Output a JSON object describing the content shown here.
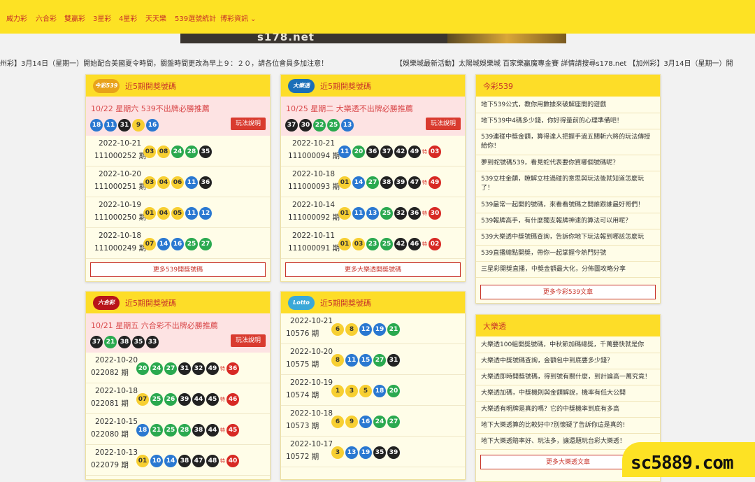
{
  "nav": {
    "items": [
      "威力彩",
      "六合彩",
      "雙贏彩",
      "3星彩",
      "4星彩",
      "天天樂",
      "539選號統計",
      "博彩資訊"
    ]
  },
  "banner": {
    "text": "s178.net"
  },
  "marquee": {
    "left": "州彩】3月14日（星期一）開始配合美國夏令時間，關盤時間更改為早上９：２０，請各位會員多加注意！",
    "right": "【娛樂城最新活動】太陽城娛樂城 百家樂贏魔專金賽 詳情請搜尋s178.net 【加州彩】3月14日（星期一）開"
  },
  "colors": {
    "nav_bg": "#fde224",
    "title_red": "#c8332a",
    "yellow": "#f7cf32",
    "green": "#2aa94f",
    "blue": "#2a78d1",
    "black": "#222222",
    "red": "#d72924"
  },
  "special_label": "特",
  "panels": {
    "p539": {
      "logo": "今彩539",
      "title": "近5期開獎號碼",
      "promo": "10/22 星期六 539不出牌必勝推薦",
      "promo_balls": [
        {
          "n": "18",
          "c": "blue"
        },
        {
          "n": "11",
          "c": "blue"
        },
        {
          "n": "31",
          "c": "black"
        },
        {
          "n": "9",
          "c": "yellow"
        },
        {
          "n": "16",
          "c": "blue"
        }
      ],
      "rules_label": "玩法說明",
      "draws": [
        {
          "date": "2022-10-21",
          "no": "111000252 期",
          "balls": [
            {
              "n": "03",
              "c": "yellow"
            },
            {
              "n": "08",
              "c": "yellow"
            },
            {
              "n": "24",
              "c": "green"
            },
            {
              "n": "28",
              "c": "green"
            },
            {
              "n": "35",
              "c": "black"
            }
          ]
        },
        {
          "date": "2022-10-20",
          "no": "111000251 期",
          "balls": [
            {
              "n": "03",
              "c": "yellow"
            },
            {
              "n": "04",
              "c": "yellow"
            },
            {
              "n": "06",
              "c": "yellow"
            },
            {
              "n": "11",
              "c": "blue"
            },
            {
              "n": "36",
              "c": "black"
            }
          ]
        },
        {
          "date": "2022-10-19",
          "no": "111000250 期",
          "balls": [
            {
              "n": "01",
              "c": "yellow"
            },
            {
              "n": "04",
              "c": "yellow"
            },
            {
              "n": "05",
              "c": "yellow"
            },
            {
              "n": "11",
              "c": "blue"
            },
            {
              "n": "12",
              "c": "blue"
            }
          ]
        },
        {
          "date": "2022-10-18",
          "no": "111000249 期",
          "balls": [
            {
              "n": "07",
              "c": "yellow"
            },
            {
              "n": "14",
              "c": "blue"
            },
            {
              "n": "16",
              "c": "blue"
            },
            {
              "n": "25",
              "c": "green"
            },
            {
              "n": "27",
              "c": "green"
            }
          ]
        }
      ],
      "more": "更多539開獎號碼"
    },
    "biglotto": {
      "logo": "大樂透",
      "title": "近5期開獎號碼",
      "promo": "10/25 星期二 大樂透不出牌必勝推薦",
      "promo_balls": [
        {
          "n": "37",
          "c": "black"
        },
        {
          "n": "30",
          "c": "black"
        },
        {
          "n": "22",
          "c": "green"
        },
        {
          "n": "25",
          "c": "green"
        },
        {
          "n": "13",
          "c": "blue"
        }
      ],
      "rules_label": "玩法說明",
      "draws": [
        {
          "date": "2022-10-21",
          "no": "111000094 期",
          "balls": [
            {
              "n": "11",
              "c": "blue"
            },
            {
              "n": "20",
              "c": "green"
            },
            {
              "n": "36",
              "c": "black"
            },
            {
              "n": "37",
              "c": "black"
            },
            {
              "n": "42",
              "c": "black"
            },
            {
              "n": "49",
              "c": "black"
            }
          ],
          "sp": "03"
        },
        {
          "date": "2022-10-18",
          "no": "111000093 期",
          "balls": [
            {
              "n": "01",
              "c": "yellow"
            },
            {
              "n": "14",
              "c": "blue"
            },
            {
              "n": "27",
              "c": "green"
            },
            {
              "n": "38",
              "c": "black"
            },
            {
              "n": "39",
              "c": "black"
            },
            {
              "n": "47",
              "c": "black"
            }
          ],
          "sp": "49"
        },
        {
          "date": "2022-10-14",
          "no": "111000092 期",
          "balls": [
            {
              "n": "01",
              "c": "yellow"
            },
            {
              "n": "11",
              "c": "blue"
            },
            {
              "n": "13",
              "c": "blue"
            },
            {
              "n": "25",
              "c": "green"
            },
            {
              "n": "32",
              "c": "black"
            },
            {
              "n": "36",
              "c": "black"
            }
          ],
          "sp": "30"
        },
        {
          "date": "2022-10-11",
          "no": "111000091 期",
          "balls": [
            {
              "n": "01",
              "c": "yellow"
            },
            {
              "n": "03",
              "c": "yellow"
            },
            {
              "n": "23",
              "c": "green"
            },
            {
              "n": "25",
              "c": "green"
            },
            {
              "n": "42",
              "c": "black"
            },
            {
              "n": "46",
              "c": "black"
            }
          ],
          "sp": "02"
        }
      ],
      "more": "更多大樂透開獎號碼"
    },
    "marksix": {
      "logo": "六合彩",
      "title": "近5期開獎號碼",
      "promo": "10/21 星期五 六合彩不出牌必勝推薦",
      "promo_balls": [
        {
          "n": "37",
          "c": "black"
        },
        {
          "n": "21",
          "c": "green"
        },
        {
          "n": "38",
          "c": "black"
        },
        {
          "n": "35",
          "c": "black"
        },
        {
          "n": "33",
          "c": "black"
        }
      ],
      "rules_label": "玩法說明",
      "draws": [
        {
          "date": "2022-10-20",
          "no": "022082 期",
          "balls": [
            {
              "n": "20",
              "c": "green"
            },
            {
              "n": "24",
              "c": "green"
            },
            {
              "n": "27",
              "c": "green"
            },
            {
              "n": "31",
              "c": "black"
            },
            {
              "n": "32",
              "c": "black"
            },
            {
              "n": "49",
              "c": "black"
            }
          ],
          "sp": "36"
        },
        {
          "date": "2022-10-18",
          "no": "022081 期",
          "balls": [
            {
              "n": "07",
              "c": "yellow"
            },
            {
              "n": "25",
              "c": "green"
            },
            {
              "n": "26",
              "c": "green"
            },
            {
              "n": "39",
              "c": "black"
            },
            {
              "n": "44",
              "c": "black"
            },
            {
              "n": "45",
              "c": "black"
            }
          ],
          "sp": "46"
        },
        {
          "date": "2022-10-15",
          "no": "022080 期",
          "balls": [
            {
              "n": "18",
              "c": "blue"
            },
            {
              "n": "21",
              "c": "green"
            },
            {
              "n": "25",
              "c": "green"
            },
            {
              "n": "28",
              "c": "green"
            },
            {
              "n": "38",
              "c": "black"
            },
            {
              "n": "44",
              "c": "black"
            }
          ],
          "sp": "45"
        },
        {
          "date": "2022-10-13",
          "no": "022079 期",
          "balls": [
            {
              "n": "01",
              "c": "yellow"
            },
            {
              "n": "10",
              "c": "blue"
            },
            {
              "n": "14",
              "c": "blue"
            },
            {
              "n": "38",
              "c": "black"
            },
            {
              "n": "47",
              "c": "black"
            },
            {
              "n": "48",
              "c": "black"
            }
          ],
          "sp": "40"
        }
      ]
    },
    "lotto": {
      "logo": "Lotto",
      "title": "近5期開獎號碼",
      "draws": [
        {
          "date": "2022-10-21",
          "no": "10576 期",
          "balls": [
            {
              "n": "6",
              "c": "yellow"
            },
            {
              "n": "8",
              "c": "yellow"
            },
            {
              "n": "12",
              "c": "blue"
            },
            {
              "n": "19",
              "c": "blue"
            },
            {
              "n": "21",
              "c": "green"
            }
          ]
        },
        {
          "date": "2022-10-20",
          "no": "10575 期",
          "balls": [
            {
              "n": "8",
              "c": "yellow"
            },
            {
              "n": "11",
              "c": "blue"
            },
            {
              "n": "15",
              "c": "blue"
            },
            {
              "n": "27",
              "c": "green"
            },
            {
              "n": "31",
              "c": "black"
            }
          ]
        },
        {
          "date": "2022-10-19",
          "no": "10574 期",
          "balls": [
            {
              "n": "1",
              "c": "yellow"
            },
            {
              "n": "3",
              "c": "yellow"
            },
            {
              "n": "5",
              "c": "yellow"
            },
            {
              "n": "18",
              "c": "blue"
            },
            {
              "n": "20",
              "c": "green"
            }
          ]
        },
        {
          "date": "2022-10-18",
          "no": "10573 期",
          "balls": [
            {
              "n": "6",
              "c": "yellow"
            },
            {
              "n": "9",
              "c": "yellow"
            },
            {
              "n": "16",
              "c": "blue"
            },
            {
              "n": "24",
              "c": "green"
            },
            {
              "n": "27",
              "c": "green"
            }
          ]
        },
        {
          "date": "2022-10-17",
          "no": "10572 期",
          "balls": [
            {
              "n": "3",
              "c": "yellow"
            },
            {
              "n": "13",
              "c": "blue"
            },
            {
              "n": "19",
              "c": "blue"
            },
            {
              "n": "35",
              "c": "black"
            },
            {
              "n": "39",
              "c": "black"
            }
          ]
        }
      ]
    },
    "news539": {
      "title": "今彩539",
      "items": [
        "地下539公式，教你用數據來破解座間的遊戲",
        "地下539中4碼多少錢，你好得量前的心理準備吧！",
        "539連碰中獎金額，算得達人把握手過五關斬六將的玩法傳授給你！",
        "夢到蛇號碼539，看見蛇代表要你買哪個號碼呢？",
        "539立柱金額，瞭解立柱過碰的意思與玩法後就知道怎麼玩了！",
        "539最常一起開的號碼，來看看號碼之間誰跟誰最好哥們！",
        "539報牌高手，有什麼獨支報牌神速的算法可以用呢？",
        "539大樂透中獎號碼查詢，告訴你地下玩法報到哪該怎麼玩",
        "539直播總點開獎，帶你一起掌握今熱門好號",
        "三星彩開獎直播，中獎金額最大化，分佈圖攻略分享"
      ],
      "more": "更多今彩539文章"
    },
    "newsBig": {
      "title": "大樂透",
      "items": [
        "大樂透100組開獎號碼，中秋節加碼總獎，千萬要快就是你",
        "大樂透中獎號碼查詢，金額包中到底要多少錢？",
        "大樂透即時開獎號碼，得到號有關什麼，到計論高一萬究竟！",
        "大樂透加碼，中獎機則與金額解說，機率有低大公開",
        "大樂透有明牌是真的嗎？它的中獎機率到底有多高",
        "地下大樂透算的比較好中?別懷疑了告訴你這是真的!",
        "地下大樂透賠率好、玩法多，讓還題玩台彩大樂透！"
      ],
      "more": "更多大樂透文章"
    }
  },
  "watermark": "sc5889.com"
}
